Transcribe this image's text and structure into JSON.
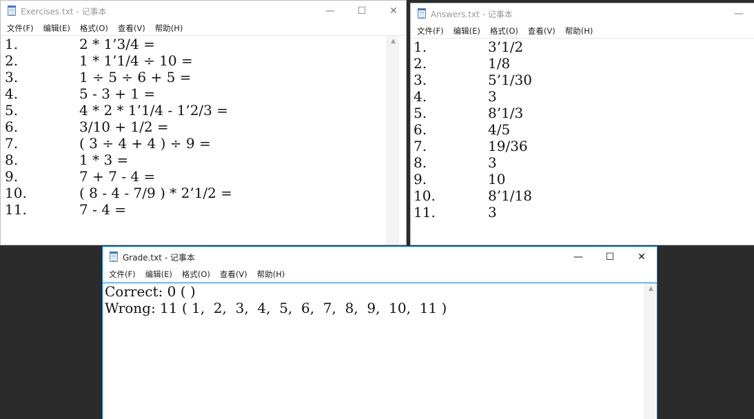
{
  "windows": {
    "exercises": {
      "title": "Exercises.txt - 记事本",
      "controls": {
        "minimize": "—",
        "maximize": "☐",
        "close": "✕"
      },
      "menu": [
        "文件(F)",
        "编辑(E)",
        "格式(O)",
        "查看(V)",
        "帮助(H)"
      ],
      "lines": [
        {
          "num": "1.",
          "text": "2 * 1’3/4 ="
        },
        {
          "num": "2.",
          "text": "1 * 1’1/4 ÷ 10 ="
        },
        {
          "num": "3.",
          "text": "1 ÷ 5 ÷ 6 + 5 ="
        },
        {
          "num": "4.",
          "text": "5 - 3 + 1 ="
        },
        {
          "num": "5.",
          "text": "4 * 2 * 1’1/4 - 1’2/3 ="
        },
        {
          "num": "6.",
          "text": "3/10 + 1/2 ="
        },
        {
          "num": "7.",
          "text": "( 3 ÷ 4 + 4 ) ÷ 9 ="
        },
        {
          "num": "8.",
          "text": "1 * 3 ="
        },
        {
          "num": "9.",
          "text": "7 + 7 - 4 ="
        },
        {
          "num": "10.",
          "text": "( 8 - 4 - 7/9 ) * 2’1/2 ="
        },
        {
          "num": "11.",
          "text": "7 - 4 ="
        }
      ]
    },
    "answers": {
      "title": "Answers.txt - 记事本",
      "controls": {
        "minimize": "—"
      },
      "menu": [
        "文件(F)",
        "编辑(E)",
        "格式(O)",
        "查看(V)",
        "帮助(H)"
      ],
      "lines": [
        {
          "num": "1.",
          "text": "3’1/2"
        },
        {
          "num": "2.",
          "text": "1/8"
        },
        {
          "num": "3.",
          "text": "5’1/30"
        },
        {
          "num": "4.",
          "text": "3"
        },
        {
          "num": "5.",
          "text": "8’1/3"
        },
        {
          "num": "6.",
          "text": "4/5"
        },
        {
          "num": "7.",
          "text": "19/36"
        },
        {
          "num": "8.",
          "text": "3"
        },
        {
          "num": "9.",
          "text": "10"
        },
        {
          "num": "10.",
          "text": "8’1/18"
        },
        {
          "num": "11.",
          "text": "3"
        }
      ]
    },
    "grade": {
      "title": "Grade.txt - 记事本",
      "controls": {
        "minimize": "—",
        "maximize": "☐",
        "close": "✕"
      },
      "menu": [
        "文件(F)",
        "编辑(E)",
        "格式(O)",
        "查看(V)",
        "帮助(H)"
      ],
      "lines": [
        "Correct: 0 ( )",
        "Wrong: 11 ( 1,  2,  3,  4,  5,  6,  7,  8,  9,  10,  11 )"
      ]
    }
  },
  "colors": {
    "accent_border": "#0078d7",
    "desktop": "#2b2b2b",
    "inactive_title": "#9a9a9a"
  }
}
